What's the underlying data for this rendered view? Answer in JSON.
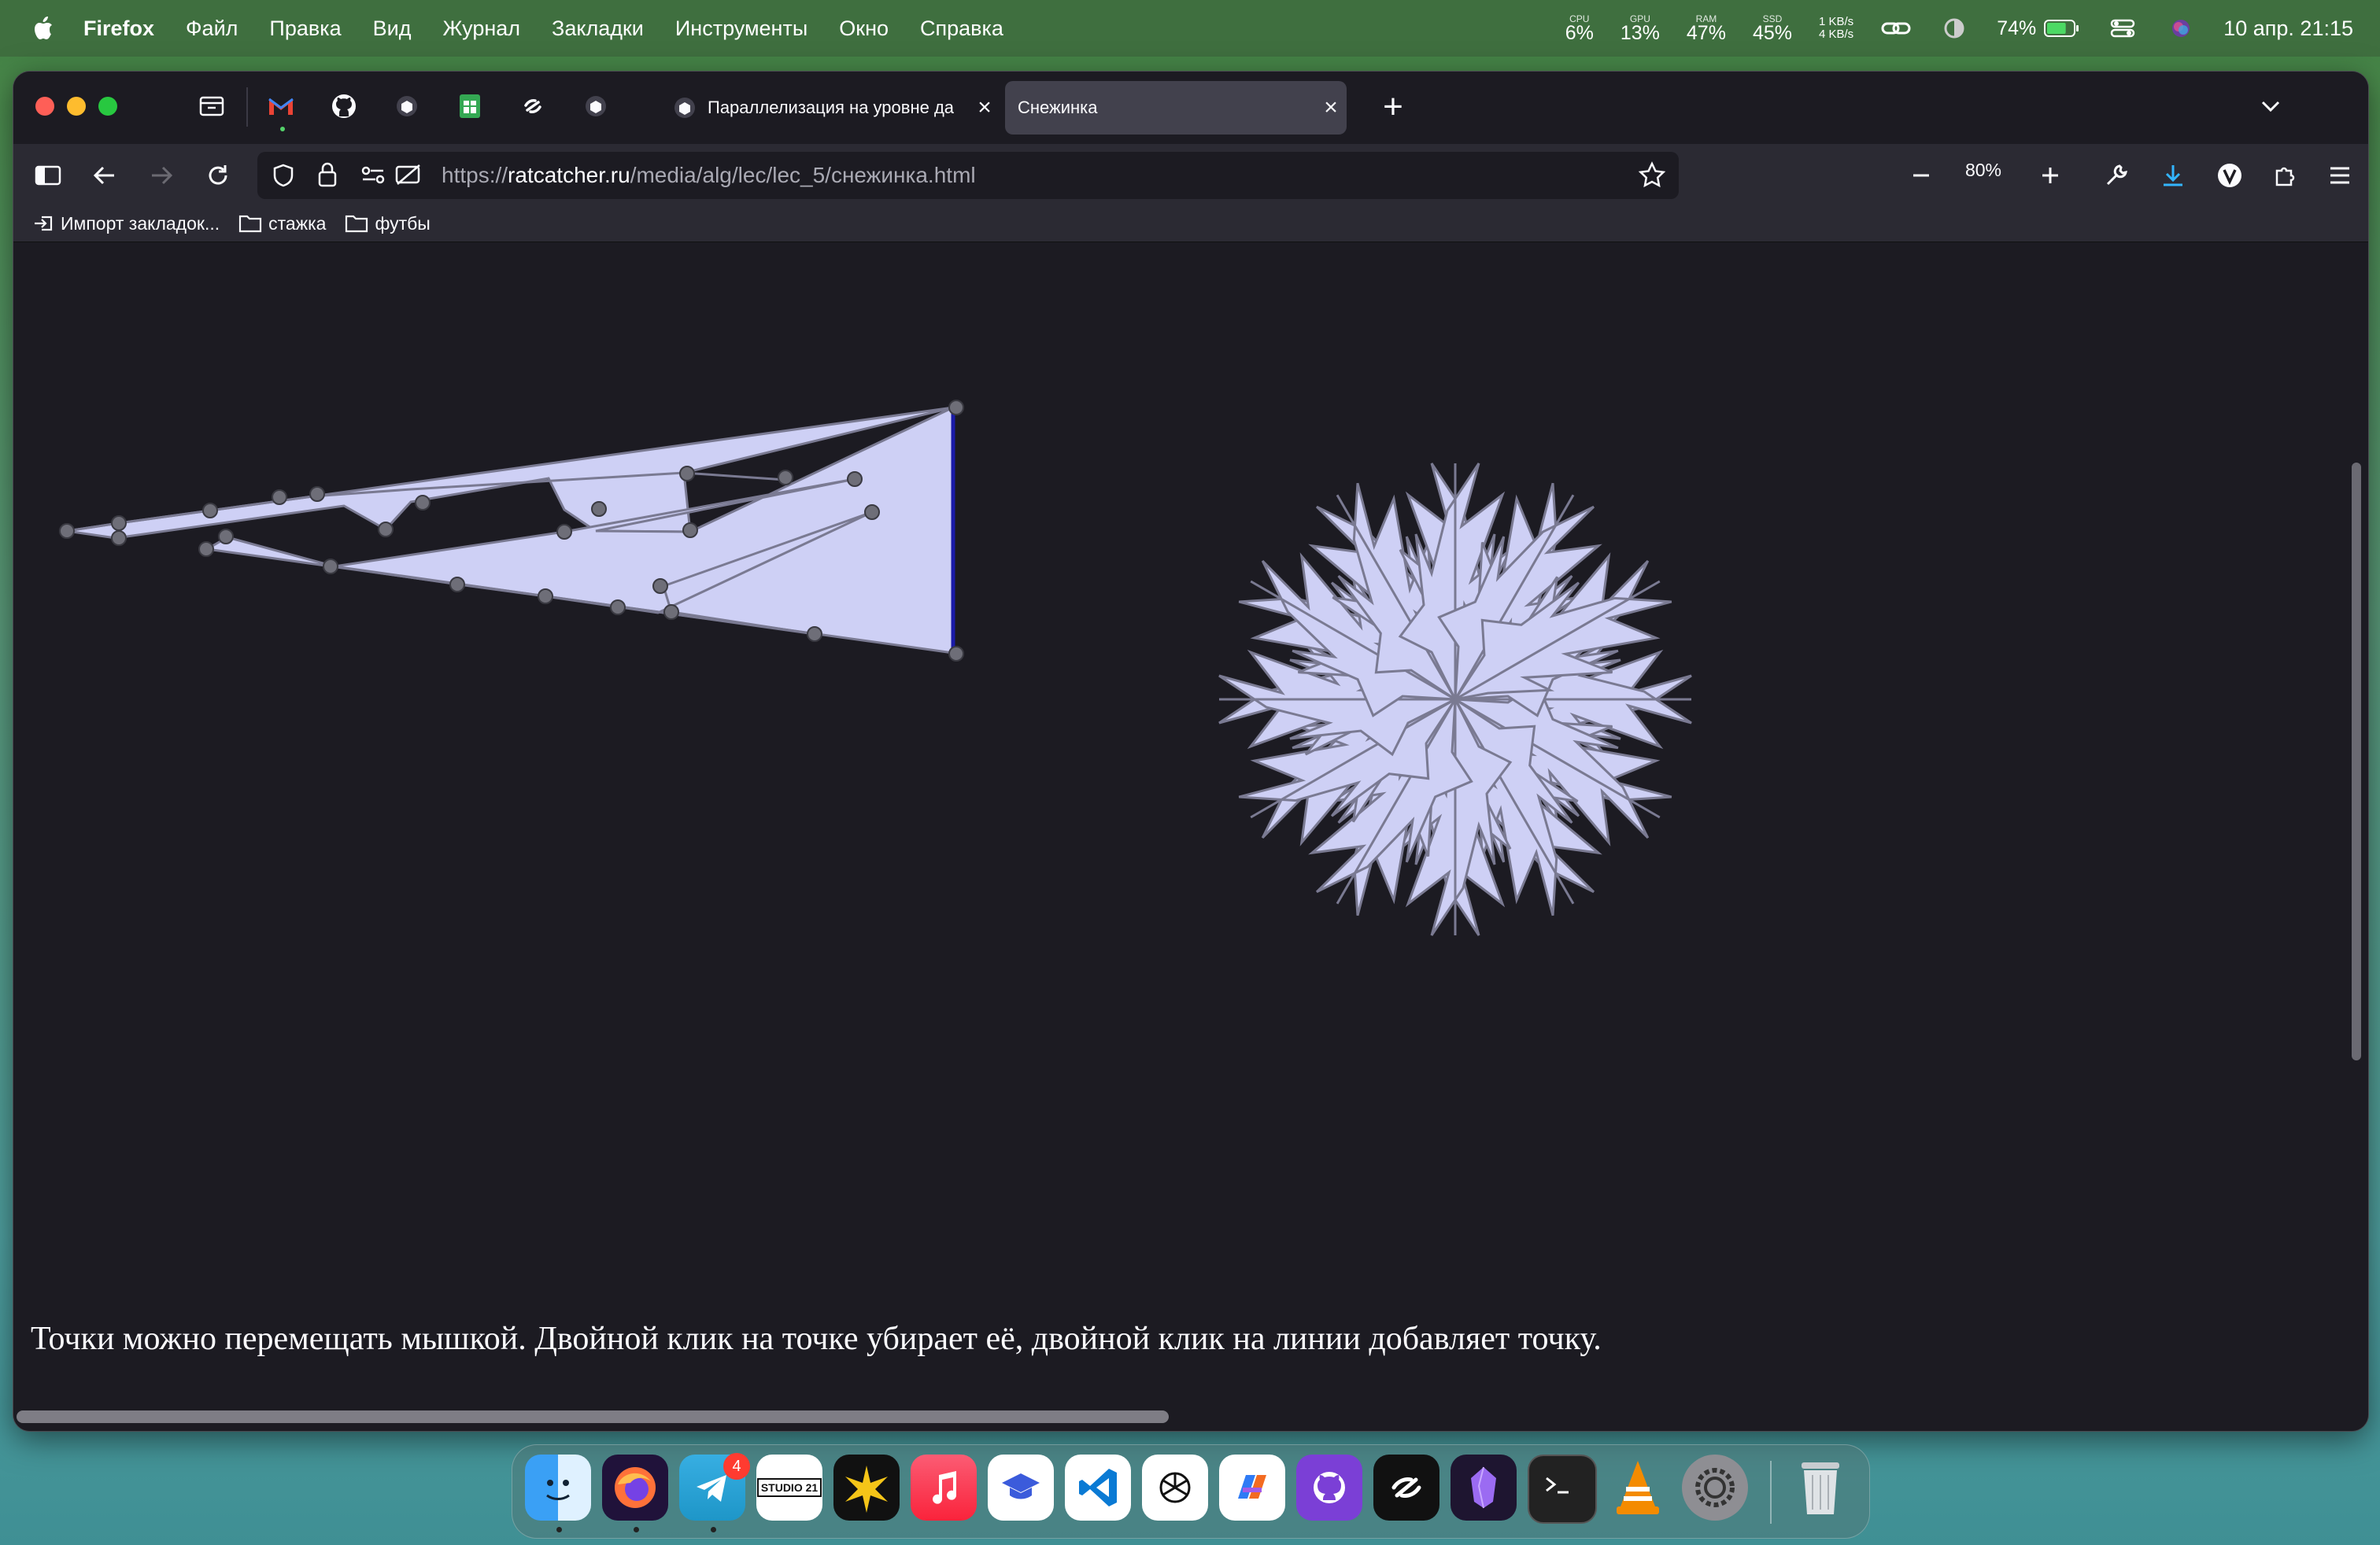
{
  "menubar": {
    "app_name": "Firefox",
    "items": [
      "Файл",
      "Правка",
      "Вид",
      "Журнал",
      "Закладки",
      "Инструменты",
      "Окно",
      "Справка"
    ],
    "stats": [
      {
        "label": "CPU",
        "value": "6%"
      },
      {
        "label": "GPU",
        "value": "13%"
      },
      {
        "label": "RAM",
        "value": "47%"
      },
      {
        "label": "SSD",
        "value": "45%"
      }
    ],
    "net_up": "1 KB/s",
    "net_down": "4 KB/s",
    "battery": "74%",
    "battery_level": 0.74,
    "clock": "10 апр.  21:15"
  },
  "browser": {
    "tabs": [
      {
        "title": "Параллелизация на уровне да",
        "active": false
      },
      {
        "title": "Снежинка",
        "active": true
      }
    ],
    "url_prefix": "https://",
    "url_host": "ratcatcher.ru",
    "url_path": "/media/alg/lec/lec_5/снежинка.html",
    "zoom": "80%",
    "bookmarks": [
      "Импорт закладок...",
      "стажка",
      "футбы"
    ],
    "accent": "#0060df"
  },
  "page": {
    "paragraph": "Точки можно перемещать мышкой. Двойной клик на точке убирает её, двойной клик на линии добавляет точку.",
    "fill_color": "#ced0f5",
    "line_color": "#7a7a92"
  },
  "dock": {
    "telegram_badge": "4",
    "studio_label": "STUDIO 21"
  }
}
